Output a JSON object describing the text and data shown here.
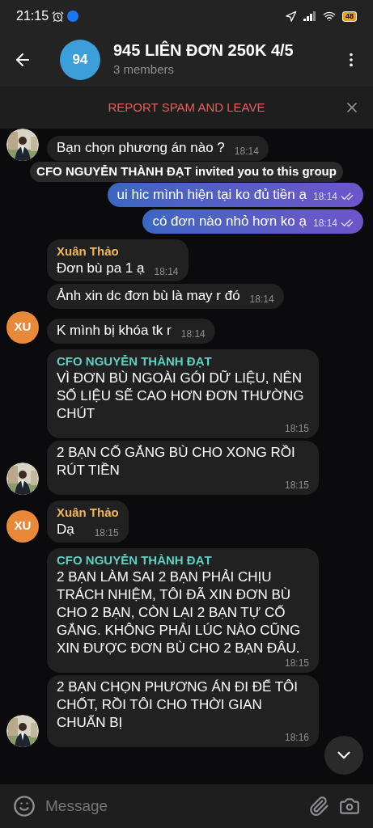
{
  "status_bar": {
    "time": "21:15",
    "battery": "48"
  },
  "header": {
    "avatar_text": "94",
    "title": "945 LIÊN ĐƠN 250K 4/5",
    "subtitle": "3 members"
  },
  "report_bar": {
    "label": "REPORT SPAM AND LEAVE"
  },
  "service_message": "CFO NGUYỄN THÀNH ĐẠT invited you to this group",
  "messages": [
    {
      "kind": "incoming",
      "text": "Bạn chọn phương án nào ?",
      "time": "18:14"
    },
    {
      "kind": "outgoing",
      "text": "ui hic mình hiện tại ko đủ tiền ạ",
      "time": "18:14",
      "read": true
    },
    {
      "kind": "outgoing",
      "text": "có đơn nào nhỏ hơn ko ạ",
      "time": "18:14",
      "read": true
    },
    {
      "kind": "incoming",
      "sender": {
        "name": "Xuân Thảo",
        "color": "#f0b85a"
      },
      "text": "Đơn bù pa 1 ạ",
      "time": "18:14"
    },
    {
      "kind": "incoming",
      "text": "Ảnh xin dc đơn bù là may r đó",
      "time": "18:14"
    },
    {
      "kind": "incoming",
      "text": "K mình bị khóa tk r",
      "time": "18:14",
      "avatar": {
        "kind": "initials",
        "text": "XU",
        "color": "#e8893a"
      }
    },
    {
      "kind": "incoming",
      "sender": {
        "name": "CFO NGUYỄN THÀNH ĐẠT",
        "color": "#5fd0c4"
      },
      "text": "VÌ ĐƠN BÙ NGOÀI GÓI DỮ LIỆU, NÊN SỐ LIỆU SẼ CAO HƠN ĐƠN THƯỜNG CHÚT",
      "time": "18:15"
    },
    {
      "kind": "incoming",
      "text": "2 BẠN CỐ GẮNG BÙ CHO XONG RỒI RÚT TIỀN",
      "time": "18:15"
    },
    {
      "kind": "incoming",
      "sender": {
        "name": "Xuân Thảo",
        "color": "#f0b85a"
      },
      "text": "Dạ",
      "time": "18:15",
      "avatar": {
        "kind": "initials",
        "text": "XU",
        "color": "#e8893a"
      }
    },
    {
      "kind": "incoming",
      "sender": {
        "name": "CFO NGUYỄN THÀNH ĐẠT",
        "color": "#5fd0c4"
      },
      "text": "2 BẠN LÀM SAI 2 BẠN PHẢI CHỊU TRÁCH NHIỆM, TÔI ĐÃ XIN ĐƠN BÙ CHO 2 BẠN, CÒN LẠI 2 BẠN TỰ CỐ GẮNG. KHÔNG PHẢI LÚC NÀO CŨNG XIN ĐƯỢC ĐƠN BÙ CHO 2 BẠN ĐÂU.",
      "time": "18:15"
    },
    {
      "kind": "incoming",
      "text": "2 BẠN CHỌN PHƯƠNG ÁN ĐI ĐỂ TÔI CHỐT, RỒI TÔI CHO THỜI GIAN CHUẨN BỊ",
      "time": "18:16"
    }
  ],
  "composer": {
    "placeholder": "Message"
  }
}
